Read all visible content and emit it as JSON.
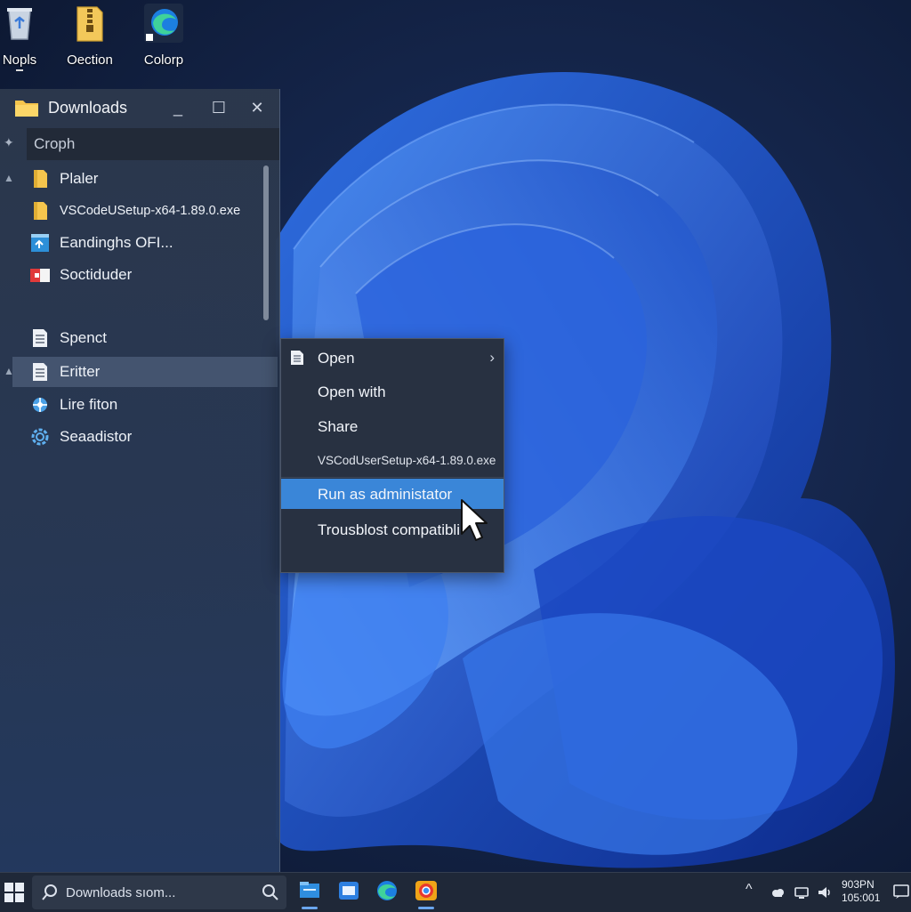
{
  "desktop": {
    "icons": [
      {
        "label": "Nopls",
        "icon": "recycle-bin-icon"
      },
      {
        "label": "Oection",
        "icon": "archive-folder-icon"
      },
      {
        "label": "Colorp",
        "icon": "edge-browser-icon"
      }
    ]
  },
  "explorer": {
    "title": "Downloads",
    "search_text": "Croph",
    "window_buttons": {
      "minimize": "_",
      "maximize": "☐",
      "close": "✕"
    },
    "items": [
      {
        "name": "Plaler",
        "icon": "folder-icon"
      },
      {
        "name": "VSCodeUSetup-x64-1.89.0.exe",
        "icon": "folder-icon"
      },
      {
        "name": "Eandinghs OFI...",
        "icon": "installer-icon"
      },
      {
        "name": "Soctiduder",
        "icon": "app-icon"
      },
      {
        "name": "Spenct",
        "icon": "document-icon"
      },
      {
        "name": "Eritter",
        "icon": "document-icon"
      },
      {
        "name": "Lire fiton",
        "icon": "network-icon"
      },
      {
        "name": "Seaadistor",
        "icon": "settings-icon"
      }
    ]
  },
  "context_menu": {
    "items": [
      {
        "label": "Open",
        "has_submenu": true
      },
      {
        "label": "Open with"
      },
      {
        "label": "Share"
      },
      {
        "label": "VSCodUserSetup-x64-1.89.0.exe"
      },
      {
        "label": "Run as administator",
        "highlighted": true
      },
      {
        "label": "Trousblost compatibli"
      }
    ],
    "submenu_arrow": "›"
  },
  "taskbar": {
    "search_text": "Downloads sıom...",
    "clock": {
      "time": "903PN",
      "date": "105:001"
    },
    "apps": [
      "file-explorer-icon",
      "store-icon",
      "edge-icon",
      "chrome-icon"
    ],
    "tray_chevron": "^"
  },
  "colors": {
    "accent": "#3a86d8",
    "taskbar": "#1f2838",
    "menu_bg": "#283141"
  }
}
